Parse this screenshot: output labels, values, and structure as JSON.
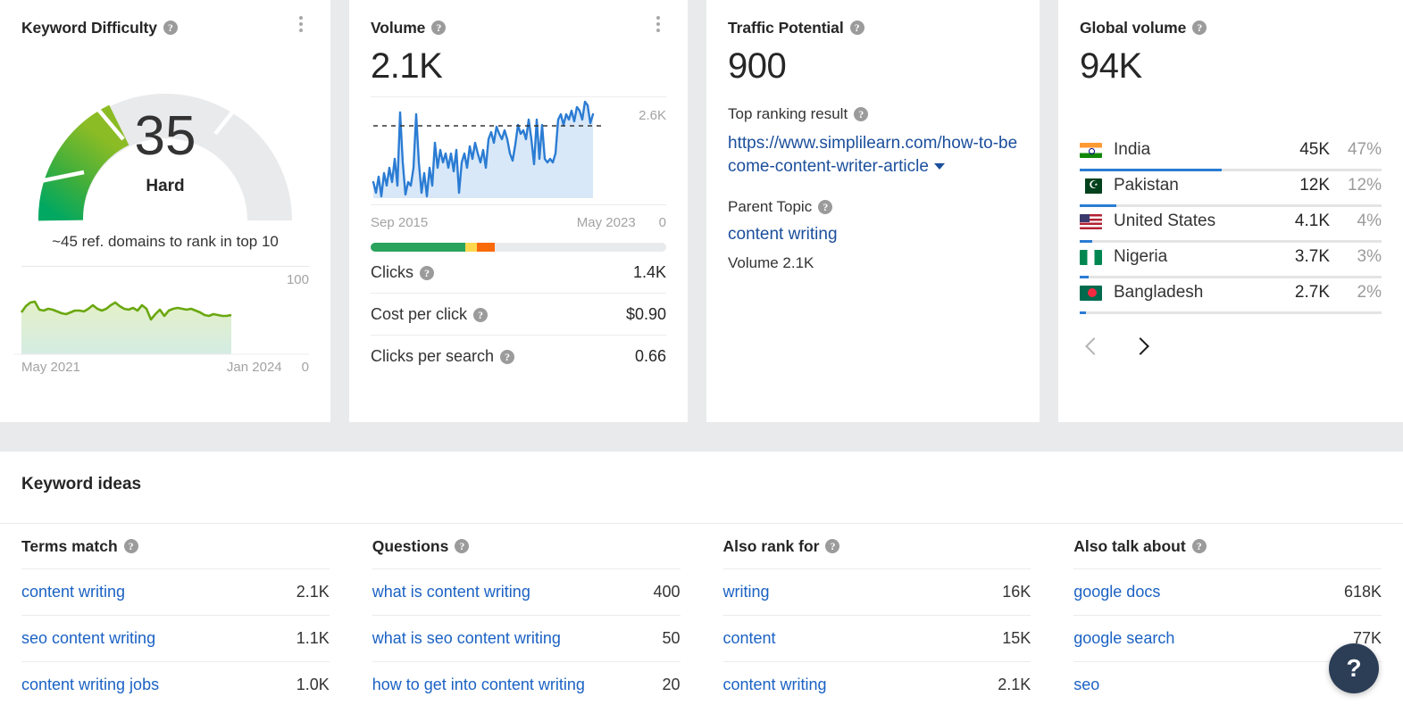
{
  "cards": {
    "kd": {
      "title": "Keyword Difficulty",
      "help_icon": "question-mark-icon",
      "menu_icon": "kebab-menu-icon",
      "score": "35",
      "score_label": "Hard",
      "subtitle": "~45 ref. domains to rank in top 10",
      "chart_max": "100",
      "chart_min": "0",
      "axis_start": "May 2021",
      "axis_end": "Jan 2024"
    },
    "volume": {
      "title": "Volume",
      "value": "2.1K",
      "chart_max": "2.6K",
      "chart_min": "0",
      "axis_start": "Sep 2015",
      "axis_end": "May 2023",
      "metrics": [
        {
          "label": "Clicks",
          "value": "1.4K"
        },
        {
          "label": "Cost per click",
          "value": "$0.90"
        },
        {
          "label": "Clicks per search",
          "value": "0.66"
        }
      ]
    },
    "traffic": {
      "title": "Traffic Potential",
      "value": "900",
      "top_result_label": "Top ranking result",
      "top_result_url": "https://www.simplilearn.com/how-to-become-content-writer-article",
      "parent_topic_label": "Parent Topic",
      "parent_topic": "content writing",
      "parent_volume": "Volume 2.1K"
    },
    "global": {
      "title": "Global volume",
      "value": "94K",
      "countries": [
        {
          "name": "India",
          "volume": "45K",
          "percent": "47%",
          "bar": 47,
          "flag": "flag-in"
        },
        {
          "name": "Pakistan",
          "volume": "12K",
          "percent": "12%",
          "bar": 12,
          "flag": "flag-pk"
        },
        {
          "name": "United States",
          "volume": "4.1K",
          "percent": "4%",
          "bar": 4,
          "flag": "flag-us"
        },
        {
          "name": "Nigeria",
          "volume": "3.7K",
          "percent": "3%",
          "bar": 3,
          "flag": "flag-ng"
        },
        {
          "name": "Bangladesh",
          "volume": "2.7K",
          "percent": "2%",
          "bar": 2,
          "flag": "flag-bd"
        }
      ],
      "prev_icon": "chevron-left-icon",
      "next_icon": "chevron-right-icon"
    }
  },
  "ideas": {
    "title": "Keyword ideas",
    "columns": [
      {
        "header": "Terms match",
        "rows": [
          {
            "keyword": "content writing",
            "volume": "2.1K"
          },
          {
            "keyword": "seo content writing",
            "volume": "1.1K"
          },
          {
            "keyword": "content writing jobs",
            "volume": "1.0K"
          }
        ]
      },
      {
        "header": "Questions",
        "rows": [
          {
            "keyword": "what is content writing",
            "volume": "400"
          },
          {
            "keyword": "what is seo content writing",
            "volume": "50"
          },
          {
            "keyword": "how to get into content writing",
            "volume": "20"
          }
        ]
      },
      {
        "header": "Also rank for",
        "rows": [
          {
            "keyword": "writing",
            "volume": "16K"
          },
          {
            "keyword": "content",
            "volume": "15K"
          },
          {
            "keyword": "content writing",
            "volume": "2.1K"
          }
        ]
      },
      {
        "header": "Also talk about",
        "rows": [
          {
            "keyword": "google docs",
            "volume": "618K"
          },
          {
            "keyword": "google search",
            "volume": "77K"
          },
          {
            "keyword": "seo",
            "volume": ""
          }
        ]
      }
    ]
  },
  "help_fab": {
    "label": "?",
    "icon": "question-mark-icon"
  },
  "colors": {
    "gauge_low": "#00a862",
    "gauge_mid": "#4caf3f",
    "gauge_high": "#a5c319",
    "gauge_track": "#e9eaec",
    "volume_line": "#2b7cd3",
    "volume_fill": "#d6e6f7",
    "kd_line": "#6aa80f",
    "bar_green": "#2aa35c",
    "bar_yellow": "#ffd84d",
    "bar_orange": "#f96a0a",
    "link": "#1b62c4",
    "url_link": "#1b4f9c",
    "fab_bg": "#2c3e56"
  },
  "chart_data": [
    {
      "type": "line",
      "name": "keyword-difficulty-history",
      "title": "Keyword Difficulty",
      "xlabel": "",
      "ylabel": "",
      "x": [
        "May 2021",
        "Jan 2024"
      ],
      "ylim": [
        0,
        100
      ],
      "grid": false,
      "values": [
        38,
        41,
        44,
        43,
        36,
        37,
        38,
        36,
        34,
        33,
        35,
        36,
        37,
        36,
        35,
        38,
        41,
        38,
        36,
        38,
        41,
        43,
        40,
        38,
        37,
        39,
        36,
        41,
        38,
        27,
        33,
        37,
        31,
        36,
        38,
        39,
        38,
        37,
        38,
        36,
        35,
        33,
        30,
        29,
        31,
        30,
        29,
        29,
        30
      ]
    },
    {
      "type": "area",
      "name": "search-volume-history",
      "title": "Volume",
      "xlabel": "",
      "ylabel": "",
      "x": [
        "Sep 2015",
        "May 2023"
      ],
      "ylim": [
        0,
        2600
      ],
      "reference_line": 2100,
      "grid": false,
      "values": [
        560,
        500,
        700,
        430,
        800,
        620,
        900,
        700,
        1050,
        640,
        2350,
        1000,
        480,
        700,
        620,
        900,
        2300,
        1000,
        560,
        800,
        500,
        900,
        620,
        1450,
        900,
        1250,
        1000,
        1150,
        900,
        1150,
        850,
        1250,
        500,
        1000,
        1150,
        900,
        1300,
        1050,
        1400,
        1150,
        1000,
        1250,
        900,
        1500,
        1650,
        1450,
        1750,
        1600,
        1500,
        1700,
        1500,
        1250,
        1100,
        1400,
        1800,
        1600,
        1700,
        1500,
        1900,
        1500,
        1200,
        1900,
        1300,
        1800,
        1300,
        1250,
        1300,
        1250,
        1400,
        1900,
        2050,
        1800,
        2050,
        1900,
        2150,
        1850,
        2200,
        2150,
        1900,
        2500,
        2400,
        2000,
        2150
      ],
      "distribution": [
        {
          "label": "green",
          "percent": 32,
          "color": "#2aa35c"
        },
        {
          "label": "yellow",
          "percent": 4,
          "color": "#ffd84d"
        },
        {
          "label": "orange",
          "percent": 6,
          "color": "#f96a0a"
        },
        {
          "label": "rest",
          "percent": 58,
          "color": "#e9eaec"
        }
      ]
    },
    {
      "type": "bar",
      "name": "global-volume-by-country",
      "title": "Global volume",
      "xlabel": "",
      "ylabel": "",
      "categories": [
        "India",
        "Pakistan",
        "United States",
        "Nigeria",
        "Bangladesh"
      ],
      "values": [
        45000,
        12000,
        4100,
        3700,
        2700
      ],
      "percents": [
        47,
        12,
        4,
        3,
        2
      ],
      "total": "94K",
      "grid": false
    },
    {
      "type": "pie",
      "name": "keyword-difficulty-gauge",
      "title": "Keyword Difficulty gauge",
      "value": 35,
      "max": 100,
      "label": "Hard",
      "grid": false
    }
  ]
}
